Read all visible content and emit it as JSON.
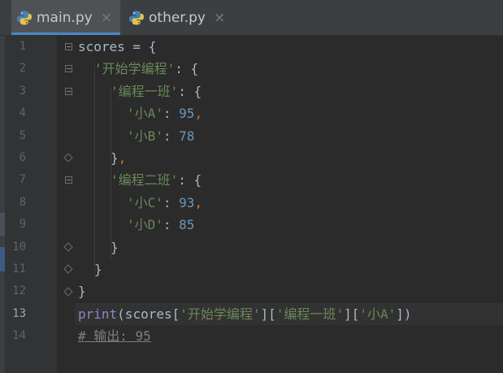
{
  "tabs": [
    {
      "label": "main.py",
      "close": "×",
      "icon": "python-file-icon",
      "active": true
    },
    {
      "label": "other.py",
      "close": "×",
      "icon": "python-file-icon",
      "active": false
    }
  ],
  "gutter": {
    "line_numbers": [
      "1",
      "2",
      "3",
      "4",
      "5",
      "6",
      "7",
      "8",
      "9",
      "10",
      "11",
      "12",
      "13",
      "14"
    ],
    "current_line": "13"
  },
  "code": {
    "l1_a": "scores = {",
    "l2_a": "'开始学编程'",
    "l2_b": ": {",
    "l3_a": "'编程一班'",
    "l3_b": ": {",
    "l4_a": "'小A'",
    "l4_b": ": ",
    "l4_c": "95",
    "l4_d": ",",
    "l5_a": "'小B'",
    "l5_b": ": ",
    "l5_c": "78",
    "l6_a": "}",
    "l6_b": ",",
    "l7_a": "'编程二班'",
    "l7_b": ": {",
    "l8_a": "'小C'",
    "l8_b": ": ",
    "l8_c": "93",
    "l8_d": ",",
    "l9_a": "'小D'",
    "l9_b": ": ",
    "l9_c": "85",
    "l10_a": "}",
    "l11_a": "}",
    "l12_a": "}",
    "l13_print": "print",
    "l13_p1": "(scores[",
    "l13_s1": "'开始学编程'",
    "l13_p2": "][",
    "l13_s2": "'编程一班'",
    "l13_p3": "][",
    "l13_s3": "'小A'",
    "l13_p4": "])",
    "l14_comment": "# 输出: 95"
  },
  "colors": {
    "background": "#2b2b2b",
    "string": "#6a8759",
    "number": "#6897bb",
    "builtin": "#8888c6",
    "comment": "#808080",
    "text": "#a9b7c6",
    "active_tab_underline": "#4a88c7"
  }
}
